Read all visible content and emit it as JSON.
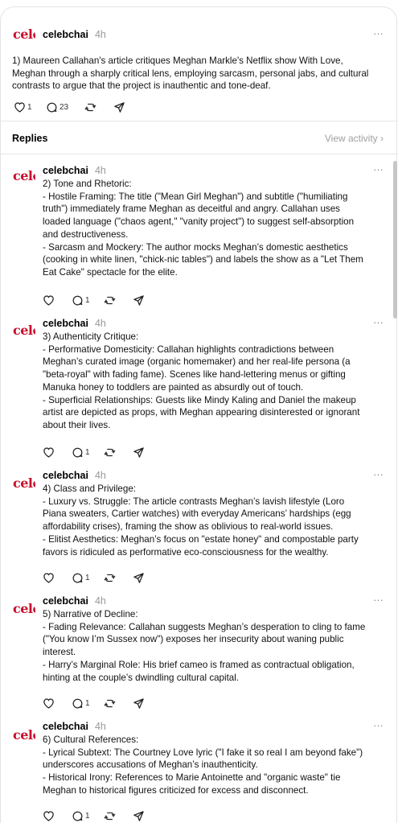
{
  "main_post": {
    "avatar_text": "cele",
    "username": "celebchai",
    "time": "4h",
    "more": "···",
    "lines": [
      "1) Maureen Callahan's article critiques Meghan Markle's Netflix show With Love,",
      "Meghan through a sharply critical lens, employing sarcasm, personal jabs, and cultural",
      "contrasts to argue that the project is inauthentic and tone-deaf."
    ],
    "likes": "1",
    "replies": "23"
  },
  "replies_header": {
    "label": "Replies",
    "view_activity": "View activity ›"
  },
  "replies": [
    {
      "avatar_text": "cele",
      "username": "celebchai",
      "time": "4h",
      "more": "···",
      "lines": [
        "2) Tone and Rhetoric:",
        "- Hostile Framing: The title (\"Mean Girl Meghan\") and subtitle (\"humiliating",
        "truth\") immediately frame Meghan as deceitful and angry. Callahan uses",
        "loaded language (\"chaos agent,\" \"vanity project\") to suggest self-absorption",
        "and destructiveness.",
        "- Sarcasm and Mockery: The author mocks Meghan’s domestic aesthetics",
        "(cooking in white linen, \"chick-nic tables\") and labels the show as a \"Let Them",
        "Eat Cake\" spectacle for the elite."
      ],
      "replies": "1"
    },
    {
      "avatar_text": "cele",
      "username": "celebchai",
      "time": "4h",
      "more": "···",
      "lines": [
        "3) Authenticity Critique:",
        "- Performative Domesticity: Callahan highlights contradictions between",
        "Meghan’s curated image (organic homemaker) and her real-life persona (a",
        "\"beta-royal\" with fading fame). Scenes like hand-lettering menus or gifting",
        "Manuka honey to toddlers are painted as absurdly out of touch.",
        "- Superficial Relationships: Guests like Mindy Kaling and Daniel the makeup",
        "artist are depicted as props, with Meghan appearing disinterested or ignorant",
        "about their lives."
      ],
      "replies": "1"
    },
    {
      "avatar_text": "cele",
      "username": "celebchai",
      "time": "4h",
      "more": "···",
      "lines": [
        "4) Class and Privilege:",
        "- Luxury vs. Struggle: The article contrasts Meghan’s lavish lifestyle (Loro",
        "Piana sweaters, Cartier watches) with everyday Americans’ hardships (egg",
        "affordability crises), framing the show as oblivious to real-world issues.",
        "- Elitist Aesthetics: Meghan’s focus on \"estate honey\" and compostable party",
        "favors is ridiculed as performative eco-consciousness for the wealthy."
      ],
      "replies": "1"
    },
    {
      "avatar_text": "cele",
      "username": "celebchai",
      "time": "4h",
      "more": "···",
      "lines": [
        "5) Narrative of Decline:",
        "- Fading Relevance: Callahan suggests Meghan’s desperation to cling to fame",
        "(\"You know I’m Sussex now\") exposes her insecurity about waning public",
        "interest.",
        "- Harry’s Marginal Role: His brief cameo is framed as contractual obligation,",
        "hinting at the couple’s dwindling cultural capital."
      ],
      "replies": "1"
    },
    {
      "avatar_text": "cele",
      "username": "celebchai",
      "time": "4h",
      "more": "···",
      "lines": [
        "6) Cultural References:",
        "- Lyrical Subtext: The Courtney Love lyric (\"I fake it so real I am beyond fake\")",
        "underscores accusations of Meghan’s inauthenticity.",
        "- Historical Irony: References to Marie Antoinette and \"organic waste\" tie",
        "Meghan to historical figures criticized for excess and disconnect."
      ],
      "replies": "1"
    }
  ],
  "colors": {
    "brand_red": "#c8102e",
    "muted_text": "#999999",
    "divider": "#e6e6e6"
  },
  "icons": [
    "heart-icon",
    "comment-icon",
    "repost-icon",
    "share-icon",
    "more-icon",
    "chevron-right-icon"
  ]
}
